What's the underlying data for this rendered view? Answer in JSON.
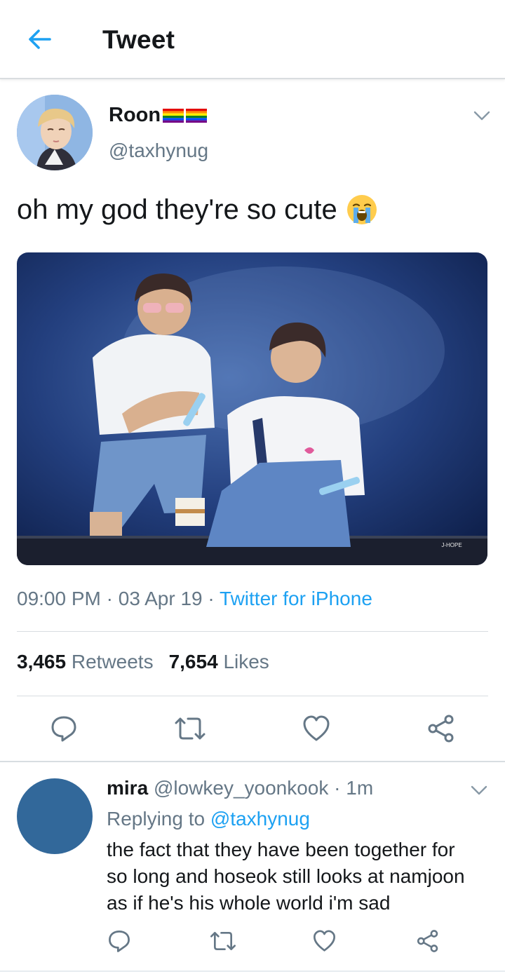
{
  "header": {
    "title": "Tweet",
    "back_icon": "arrow-left-icon",
    "accent": "#1da1f2"
  },
  "tweet": {
    "author_name": "Roon",
    "author_flags": [
      "rainbow-flag-emoji",
      "rainbow-flag-emoji"
    ],
    "author_handle": "@taxhynug",
    "text": "oh my god they're so cute",
    "text_emoji": "loudly-crying-face-emoji",
    "media": "photo of two performers sitting on a stage edge under blue stage lights",
    "time": "09:00 PM",
    "date": "03 Apr 19",
    "separator": "·",
    "source": "Twitter for iPhone",
    "retweets_count": "3,465",
    "retweets_label": "Retweets",
    "likes_count": "7,654",
    "likes_label": "Likes",
    "actions": [
      "reply-icon",
      "retweet-icon",
      "like-icon",
      "share-icon"
    ]
  },
  "reply": {
    "author_name": "mira",
    "author_handle": "@lowkey_yoonkook",
    "time_ago": "1m",
    "separator": "·",
    "replying_label": "Replying to",
    "replying_to": "@taxhynug",
    "text_lines": [
      "the fact that they have been together for",
      "so long and hoseok still looks at namjoon",
      "as if he's his whole world i'm sad"
    ],
    "avatar_color": "#32689a",
    "actions": [
      "reply-icon",
      "retweet-icon",
      "like-icon",
      "share-icon"
    ]
  },
  "colors": {
    "text_primary": "#14171a",
    "text_secondary": "#657786",
    "link": "#1da1f2",
    "divider": "#d8dde1"
  }
}
